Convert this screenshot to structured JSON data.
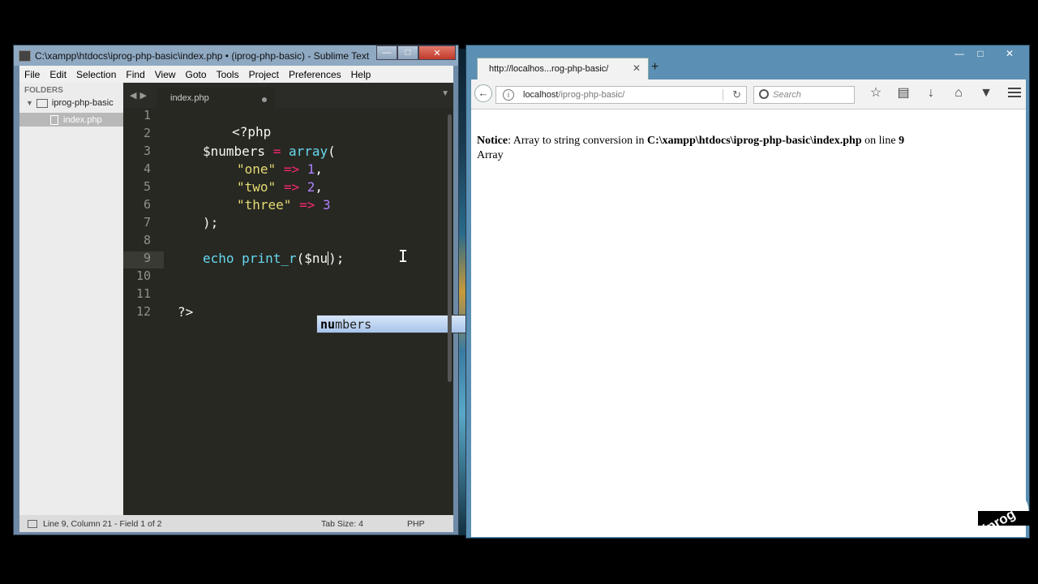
{
  "sublime": {
    "title": "C:\\xampp\\htdocs\\iprog-php-basic\\index.php • (iprog-php-basic) - Sublime Text",
    "menu": [
      "File",
      "Edit",
      "Selection",
      "Find",
      "View",
      "Goto",
      "Tools",
      "Project",
      "Preferences",
      "Help"
    ],
    "sidebar": {
      "heading": "FOLDERS",
      "folder": "iprog-php-basic",
      "file": "index.php"
    },
    "tab": {
      "name": "index.php"
    },
    "lines": [
      "1",
      "2",
      "3",
      "4",
      "5",
      "6",
      "7",
      "8",
      "9",
      "10",
      "11",
      "12"
    ],
    "code": {
      "l1": "<?php",
      "l3_var": "$numbers",
      "l3_op": "=",
      "l3_fn": "array",
      "l3_paren": "(",
      "l4_str": "\"one\"",
      "l4_op": "=>",
      "l4_num": "1",
      "l5_str": "\"two\"",
      "l5_op": "=>",
      "l5_num": "2",
      "l6_str": "\"three\"",
      "l6_op": "=>",
      "l6_num": "3",
      "l7": ");",
      "l9_echo": "echo",
      "l9_fn": "print_r",
      "l9_open": "($nu",
      "l9_close": ");",
      "l12": "?>"
    },
    "autocomplete": {
      "match": "nu",
      "rest": "mbers"
    },
    "status": {
      "position": "Line 9, Column 21 - Field 1 of 2",
      "tab_size": "Tab Size: 4",
      "syntax": "PHP"
    }
  },
  "firefox": {
    "tab_title": "http://localhos...rog-php-basic/",
    "url_host": "localhost",
    "url_path": "/iprog-php-basic/",
    "search_placeholder": "Search",
    "content": {
      "notice_label": "Notice",
      "notice_text": ": Array to string conversion in ",
      "notice_path": "C:\\xampp\\htdocs\\iprog-php-basic\\index.php",
      "notice_online": " on line ",
      "notice_line": "9",
      "output": "Array"
    }
  },
  "logo_text": "iprog"
}
